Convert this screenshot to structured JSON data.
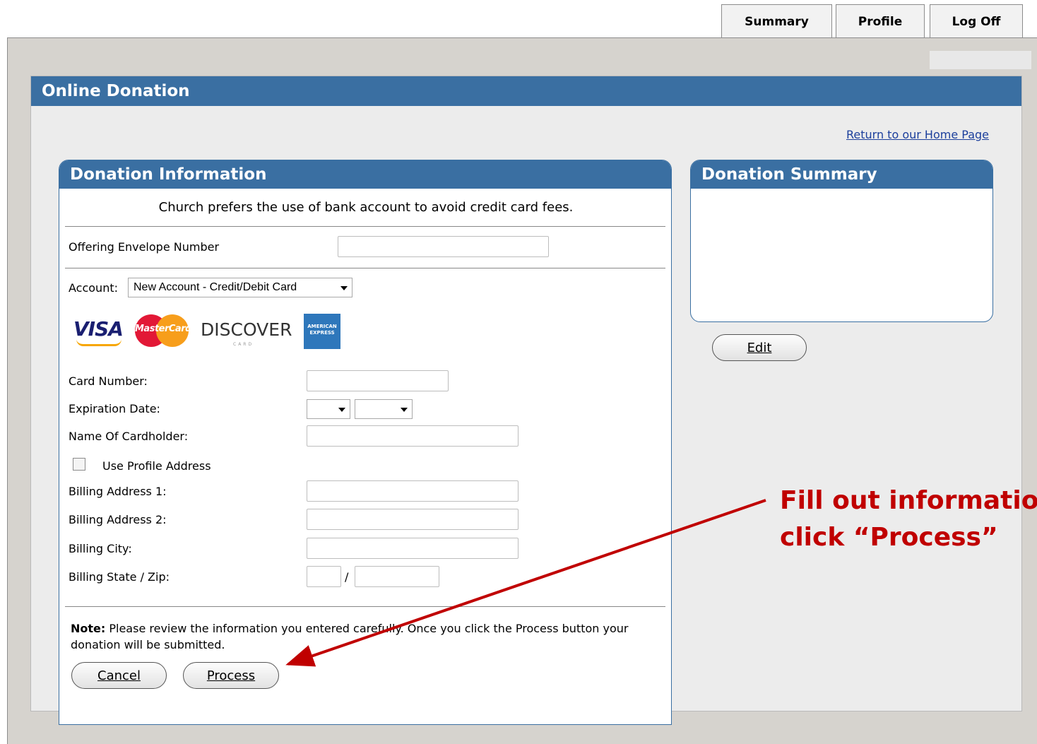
{
  "nav": {
    "tabs": [
      "Summary",
      "Profile",
      "Log Off"
    ]
  },
  "page": {
    "title": "Online Donation",
    "home_link": "Return to our Home Page"
  },
  "donation_info": {
    "title": "Donation Information",
    "message": "Church prefers the use of bank account to avoid credit card fees.",
    "envelope_label": "Offering Envelope Number",
    "envelope_value": "",
    "account_label": "Account:",
    "account_selected": "New Account - Credit/Debit Card",
    "card_logos": {
      "visa": "VISA",
      "mastercard": "MasterCard",
      "discover": "DISCOVER",
      "discover_sub": "CARD",
      "amex": "AMERICAN EXPRESS"
    },
    "card_number_label": "Card Number:",
    "expiration_label": "Expiration Date:",
    "expiration_month": "",
    "expiration_year": "",
    "cardholder_label": "Name Of Cardholder:",
    "use_profile_label": "Use Profile Address",
    "use_profile_checked": false,
    "billing1_label": "Billing Address 1:",
    "billing2_label": "Billing Address 2:",
    "city_label": "Billing City:",
    "state_zip_label": "Billing State / Zip:",
    "state_zip_separator": "/",
    "note_bold": "Note:",
    "note_text": " Please review the information you entered carefully. Once you click the Process button your donation will be submitted.",
    "cancel_label": "Cancel",
    "process_label": "Process"
  },
  "donation_summary": {
    "title": "Donation Summary",
    "edit_label": "Edit"
  },
  "annotation": {
    "line1": "Fill out informatio",
    "line2": "click “Process”",
    "color": "#c00000"
  },
  "colors": {
    "header_blue": "#3a6fa2",
    "link_blue": "#1c3f9c"
  }
}
